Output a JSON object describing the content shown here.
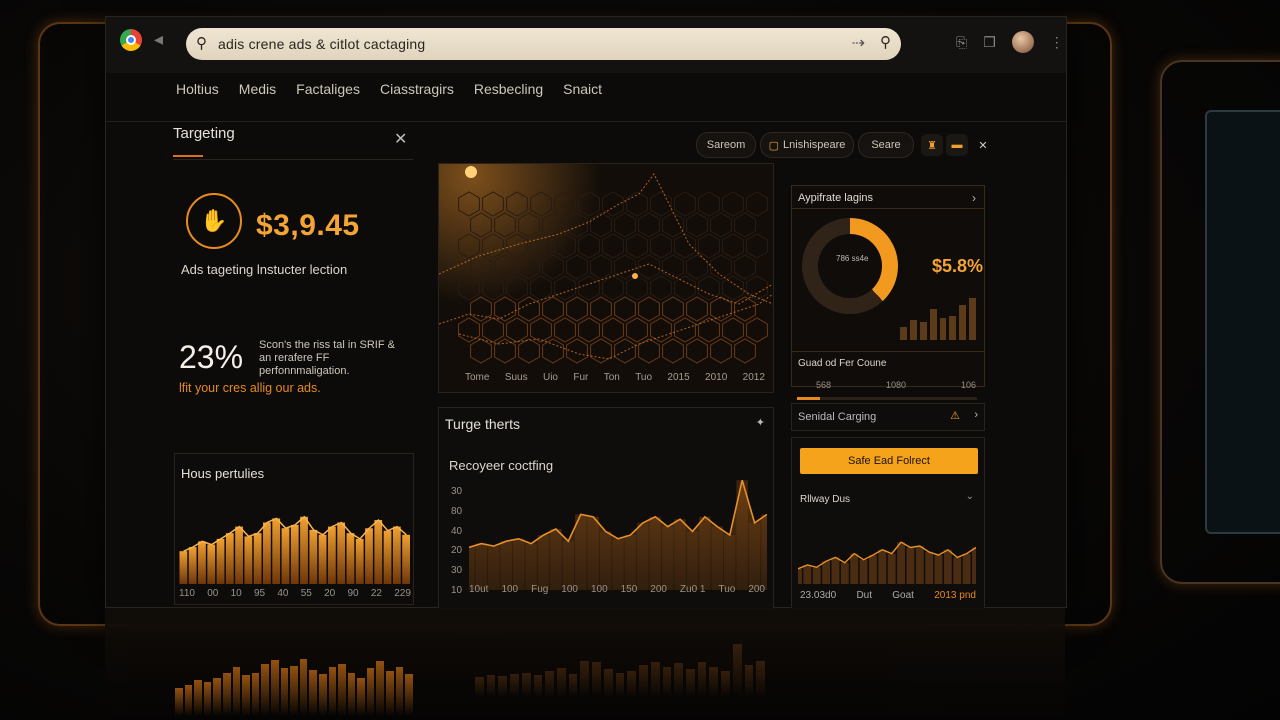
{
  "browser": {
    "url_text": "adis crene ads & citlot cactaging",
    "back_icon": "back-icon",
    "search_icon": "search-icon"
  },
  "nav": [
    "Holtius",
    "Medis",
    "Factaliges",
    "Ciasstragirs",
    "Resbecling",
    "Snaict"
  ],
  "left_panel": {
    "title": "Targeting",
    "amount": "$3,9.45",
    "amount_desc": "Ads tageting lnstucter lection",
    "percent": "23%",
    "percent_desc": "Scon's the riss tal in SRIF & an rerafere FF perfonnmaligation.",
    "percent_note": "lfit your cres allig our ads.",
    "mini_chart": {
      "title": "Hous pertulies",
      "ticks": [
        "110",
        "00",
        "10",
        "95",
        "40",
        "55",
        "20",
        "90",
        "22",
        "229"
      ]
    }
  },
  "toolbar": {
    "pill1": "Sareom",
    "pill2": "Lnishispeare",
    "pill3": "Seare"
  },
  "network_chart": {
    "ticks": [
      "Tome",
      "Suus",
      "Uio",
      "Fur",
      "Ton",
      "Tuo",
      "2015",
      "2010",
      "2012"
    ]
  },
  "center_card": {
    "title": "Turge therts",
    "subtitle": "Recoyeer coctfing",
    "yticks": [
      "30",
      "80",
      "40",
      "20",
      "30",
      "10"
    ],
    "xticks": [
      "10ut",
      "100",
      "Fug",
      "100",
      "100",
      "150",
      "200",
      "Zu0 1",
      "Tuo",
      "200"
    ]
  },
  "right_card1": {
    "title": "Aypifrate lagins",
    "donut_label": "786 ss4e",
    "percent": "$5.8%",
    "footer_title": "Guad od Fer Coune",
    "footer_vals": [
      "568",
      "1080",
      "106"
    ],
    "progress": 0.13
  },
  "right_card2": {
    "title": "Senidal Carging"
  },
  "right_card3": {
    "cta": "Safe Ead Folrect",
    "subtitle": "Rllway Dus",
    "foot": [
      "23.03d0",
      "Dut",
      "Goat",
      "2013 pnd"
    ]
  },
  "chart_data": [
    {
      "type": "bar",
      "title": "Hous pertulies",
      "categories": [
        "110",
        "00",
        "10",
        "95",
        "40",
        "55",
        "20",
        "90",
        "22",
        "229"
      ],
      "values": [
        40,
        45,
        52,
        48,
        55,
        62,
        70,
        58,
        62,
        75,
        80,
        68,
        72,
        82,
        66,
        60,
        70,
        75,
        62,
        55,
        68,
        78,
        65,
        70,
        60
      ]
    },
    {
      "type": "area",
      "title": "Recoyeer coctfing",
      "values": [
        35,
        38,
        36,
        40,
        42,
        38,
        45,
        50,
        40,
        62,
        60,
        48,
        42,
        45,
        55,
        60,
        52,
        58,
        48,
        60,
        52,
        45,
        90,
        55,
        62
      ]
    },
    {
      "type": "bar",
      "title": "Aypifrate lagins",
      "values": [
        30,
        45,
        40,
        70,
        50,
        55,
        80,
        95
      ]
    },
    {
      "type": "area",
      "title": "Rllway Dus",
      "values": [
        20,
        25,
        22,
        30,
        35,
        28,
        40,
        32,
        38,
        45,
        40,
        55,
        48,
        50,
        42,
        38,
        45,
        35,
        40,
        48
      ]
    }
  ]
}
